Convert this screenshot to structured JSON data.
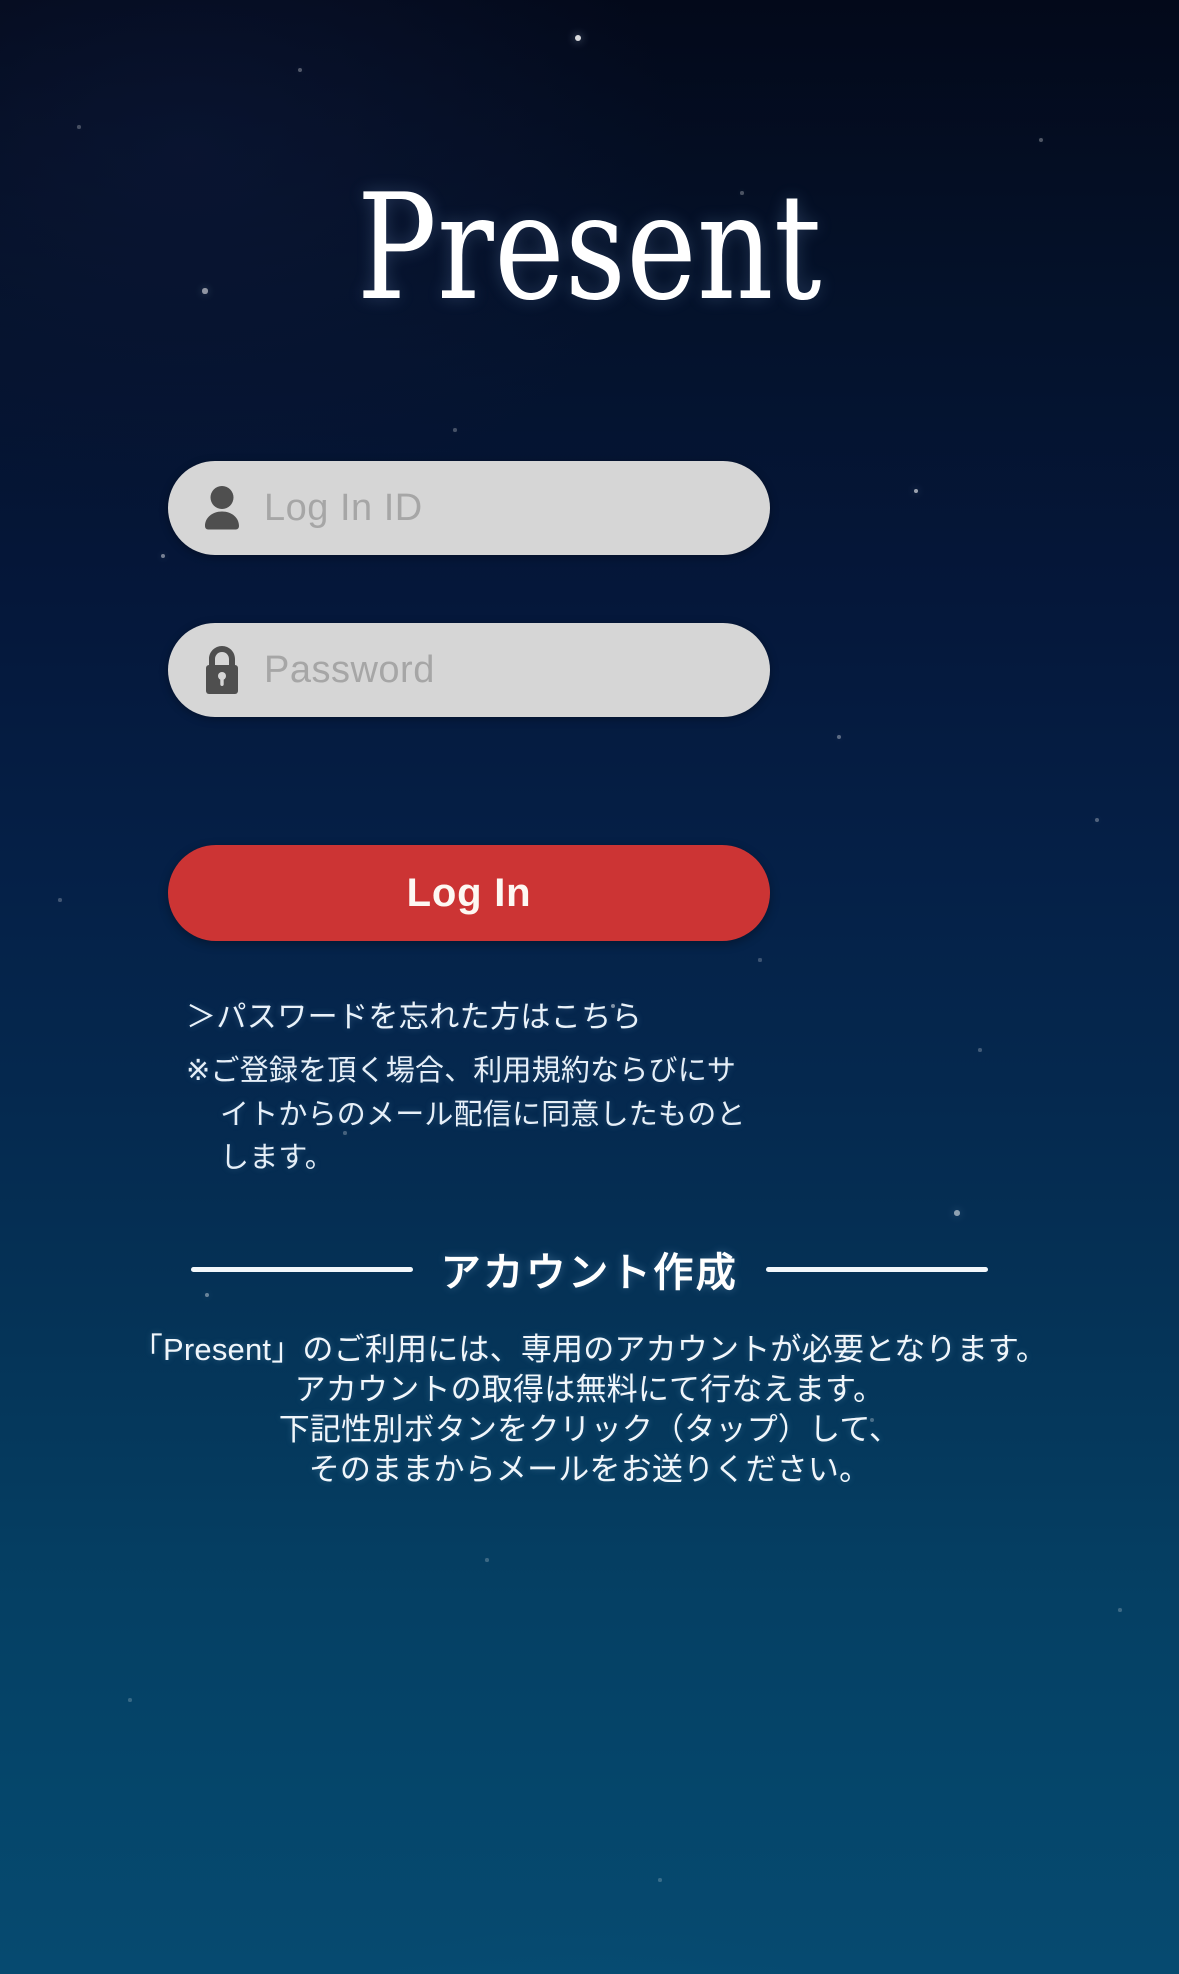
{
  "app": {
    "logo_text": "Present",
    "background_top_color": "#03091a",
    "background_bottom_color": "#064a70"
  },
  "form": {
    "id_field": {
      "icon": "user-icon",
      "placeholder": "Log In ID",
      "value": ""
    },
    "password_field": {
      "icon": "lock-icon",
      "placeholder": "Password",
      "value": ""
    },
    "submit_label": "Log In",
    "submit_color": "#cc3434"
  },
  "links": {
    "forgot_password": "＞パスワードを忘れた方はこちら"
  },
  "notice": {
    "marker": "※",
    "text": "ご登録を頂く場合、利用規約ならびにサイトからのメール配信に同意したものとします。"
  },
  "signup": {
    "divider_title": "アカウント作成",
    "lines": [
      "「Present」のご利用には、専用のアカウントが必要となります。",
      "アカウントの取得は無料にて行なえます。",
      "下記性別ボタンをクリック（タップ）して、",
      "そのままからメールをお送りください。"
    ]
  }
}
